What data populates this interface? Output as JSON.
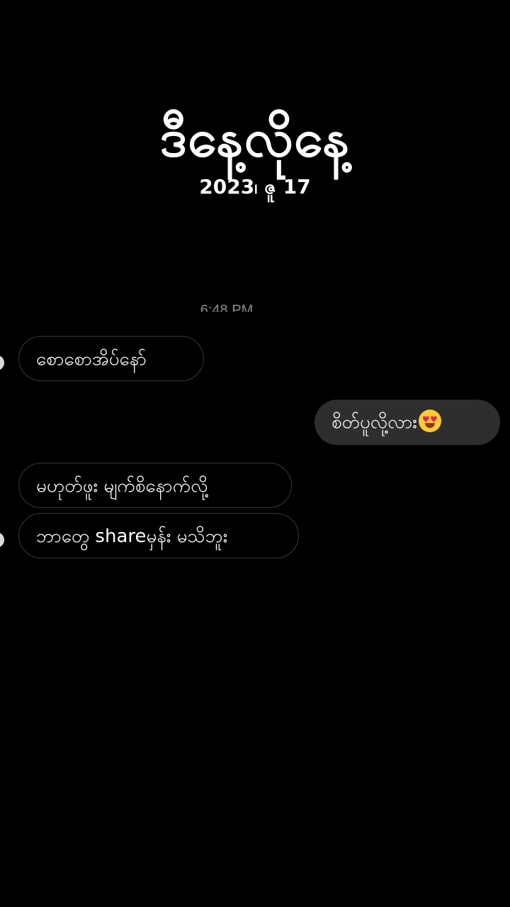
{
  "header": {
    "title": "ဒီနေ့လိုနေ့",
    "date": "2023၊ ဇူ 17"
  },
  "chat": {
    "timestamp": "6:48 PM",
    "messages": [
      {
        "direction": "received",
        "text": "စောစောအိပ်နော်"
      },
      {
        "direction": "sent",
        "text": "စိတ်ပူလို့လား",
        "emoji": "smiling-face-with-heart-eyes"
      },
      {
        "direction": "received",
        "text": "မဟုတ်ဖူး မျက်စိနောက်လို့"
      },
      {
        "direction": "received",
        "text": "ဘာတွေ shareမှန်း မသိဘူး"
      }
    ]
  },
  "colors": {
    "background": "#000000",
    "text": "#ffffff",
    "sent_bubble": "#2e2e2e",
    "received_border": "#3a3a3a",
    "timestamp": "#8a8a8a"
  }
}
